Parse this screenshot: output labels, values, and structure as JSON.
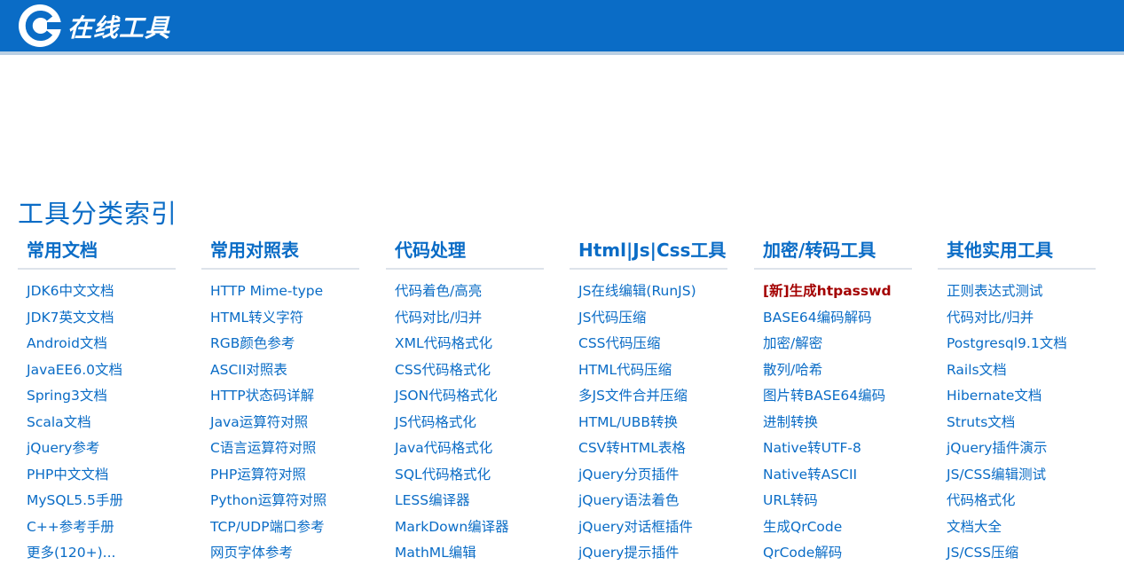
{
  "header": {
    "logo_text": "在线工具",
    "brand_color": "#0a6cc6"
  },
  "section_title": "工具分类索引",
  "columns": [
    {
      "title": "常用文档",
      "items": [
        "JDK6中文文档",
        "JDK7英文文档",
        "Android文档",
        "JavaEE6.0文档",
        "Spring3文档",
        "Scala文档",
        "jQuery参考",
        "PHP中文文档",
        "MySQL5.5手册",
        "C++参考手册",
        "更多(120+)..."
      ]
    },
    {
      "title": "常用对照表",
      "items": [
        "HTTP Mime-type",
        "HTML转义字符",
        "RGB颜色参考",
        "ASCII对照表",
        "HTTP状态码详解",
        "Java运算符对照",
        "C语言运算符对照",
        "PHP运算符对照",
        "Python运算符对照",
        "TCP/UDP端口参考",
        "网页字体参考"
      ]
    },
    {
      "title": "代码处理",
      "items": [
        "代码着色/高亮",
        "代码对比/归并",
        "XML代码格式化",
        "CSS代码格式化",
        "JSON代码格式化",
        "JS代码格式化",
        "Java代码格式化",
        "SQL代码格式化",
        "LESS编译器",
        "MarkDown编译器",
        "MathML编辑"
      ]
    },
    {
      "title": "Html|Js|Css工具",
      "items": [
        "JS在线编辑(RunJS)",
        "JS代码压缩",
        "CSS代码压缩",
        "HTML代码压缩",
        "多JS文件合并压缩",
        "HTML/UBB转换",
        "CSV转HTML表格",
        "jQuery分页插件",
        "jQuery语法着色",
        "jQuery对话框插件",
        "jQuery提示插件"
      ]
    },
    {
      "title": "加密/转码工具",
      "items": [
        "[新]生成htpasswd",
        "BASE64编码解码",
        "加密/解密",
        "散列/哈希",
        "图片转BASE64编码",
        "进制转换",
        "Native转UTF-8",
        "Native转ASCII",
        "URL转码",
        "生成QrCode",
        "QrCode解码"
      ]
    },
    {
      "title": "其他实用工具",
      "items": [
        "正则表达式测试",
        "代码对比/归并",
        "Postgresql9.1文档",
        "Rails文档",
        "Hibernate文档",
        "Struts文档",
        "jQuery插件演示",
        "JS/CSS编辑测试",
        "代码格式化",
        "文档大全",
        "JS/CSS压缩"
      ]
    }
  ]
}
